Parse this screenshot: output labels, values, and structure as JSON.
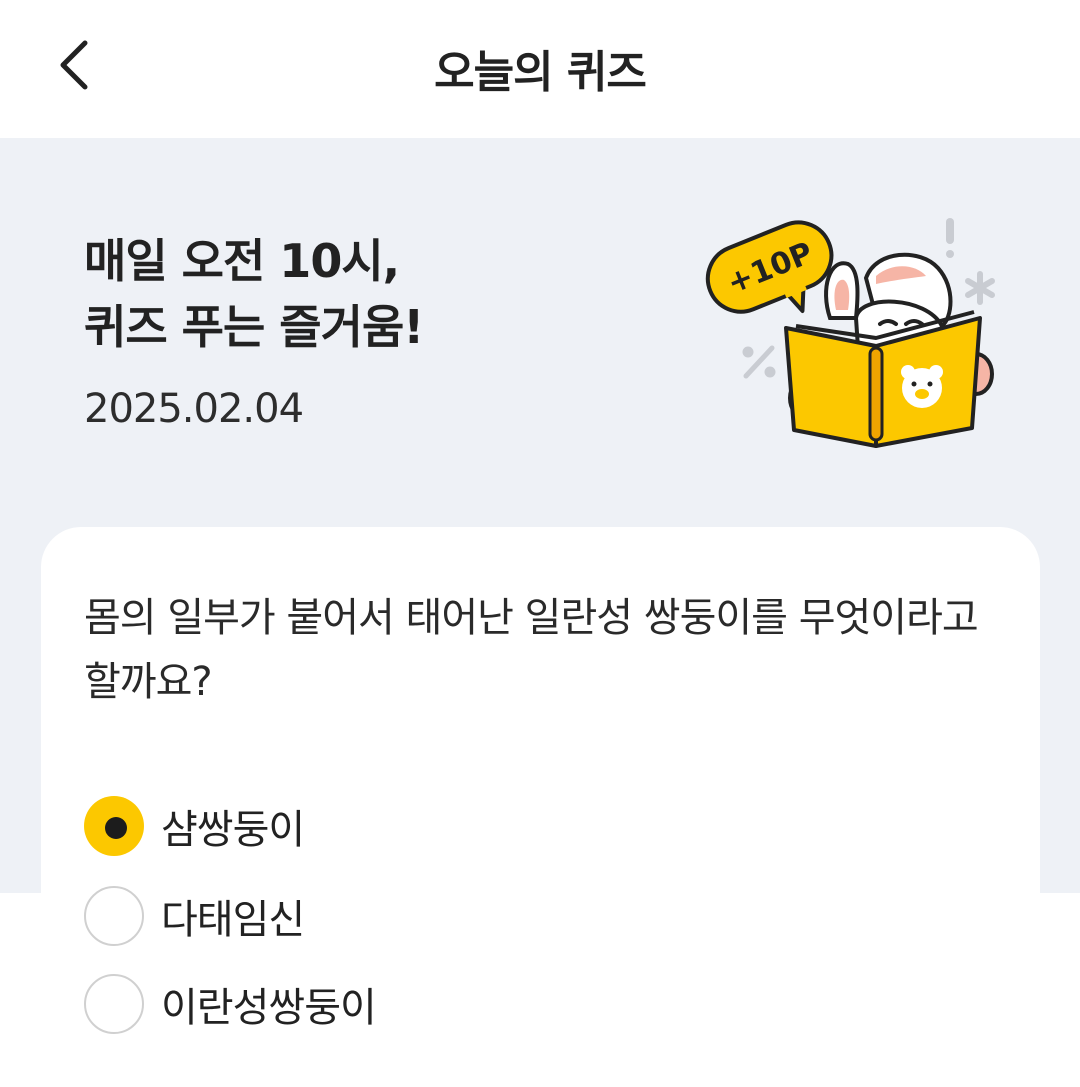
{
  "header": {
    "title": "오늘의 퀴즈"
  },
  "hero": {
    "headline_line1": "매일 오전 10시,",
    "headline_line2": "퀴즈 푸는 즐거움!",
    "date": "2025.02.04",
    "badge_text": "+10P"
  },
  "quiz": {
    "question": "몸의 일부가 붙어서 태어난 일란성 쌍둥이를 무엇이라고 할까요?",
    "options": [
      {
        "label": "샴쌍둥이",
        "selected": true
      },
      {
        "label": "다태임신",
        "selected": false
      },
      {
        "label": "이란성쌍둥이",
        "selected": false
      }
    ]
  },
  "colors": {
    "accent": "#fcc800",
    "background": "#eef1f6",
    "card": "#ffffff"
  }
}
